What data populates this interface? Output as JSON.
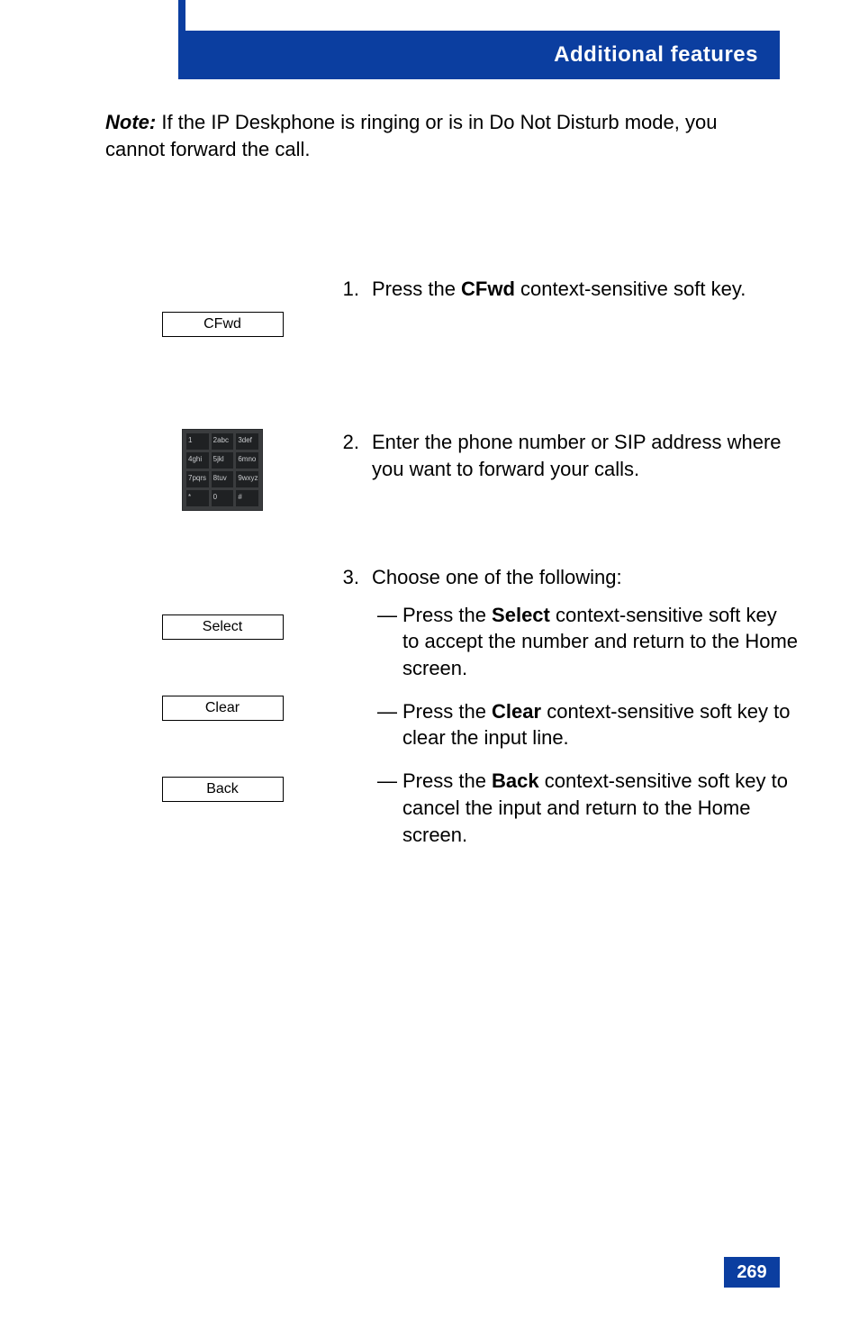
{
  "header": {
    "title": "Additional features"
  },
  "intro": {
    "note_label": "Note:",
    "text_after": " If the IP Deskphone is ringing or is in Do Not Disturb mode, you cannot forward the call."
  },
  "softkeys": {
    "cfwd": "CFwd",
    "select": "Select",
    "clear": "Clear",
    "back": "Back"
  },
  "keypad": {
    "keys": [
      "1",
      "2abc",
      "3def",
      "4ghi",
      "5jkl",
      "6mno",
      "7pqrs",
      "8tuv",
      "9wxyz",
      "*",
      "0",
      "#"
    ]
  },
  "steps": {
    "s1": {
      "num": "1.",
      "pre": "Press the ",
      "key": "CFwd",
      "post": " context-sensitive soft key."
    },
    "s2": {
      "num": "2.",
      "text": "Enter the phone number or SIP address where you want to forward your calls."
    },
    "s3": {
      "num": "3.",
      "lead": "Choose one of the following:",
      "opts": [
        {
          "pre": "Press the ",
          "key": "Select",
          "post": " context-sensitive soft key to accept the number and return to the Home screen."
        },
        {
          "pre": "Press the ",
          "key": "Clear",
          "post": " context-sensitive soft key to clear the input line."
        },
        {
          "pre": "Press the ",
          "key": "Back",
          "post": " context-sensitive soft key to cancel the input and return to the Home screen."
        }
      ]
    }
  },
  "page_number": "269",
  "dash": "—"
}
